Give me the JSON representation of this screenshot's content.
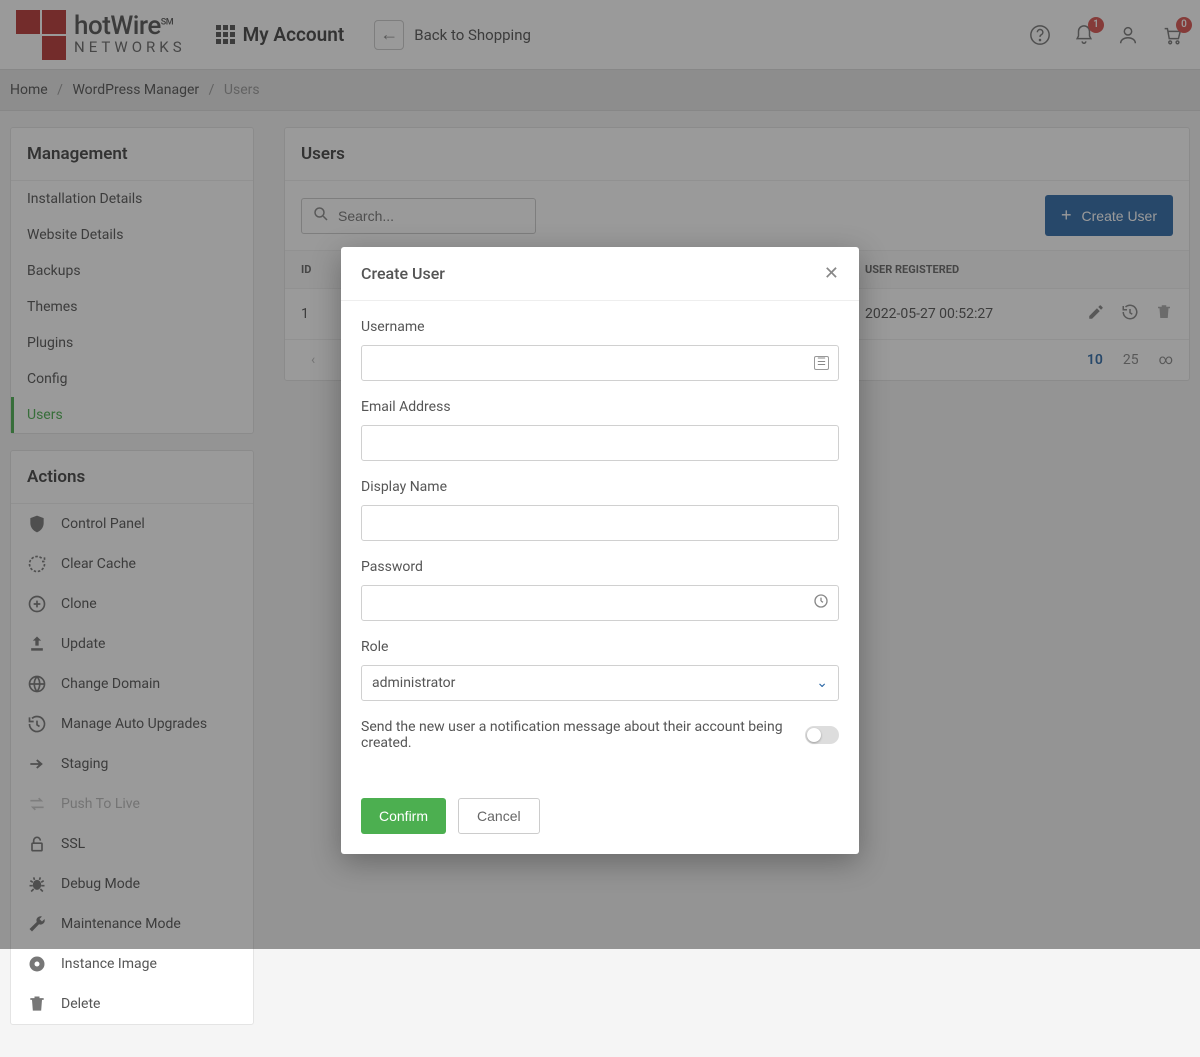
{
  "colors": {
    "accent_blue": "#2f6aa8",
    "accent_green": "#4caf50",
    "brand_red": "#b83836",
    "badge_red": "#d9534f"
  },
  "header": {
    "brand_line1": "hotWire",
    "brand_sup": "SM",
    "brand_line2": "NETWORKS",
    "title": "My Account",
    "back_label": "Back to Shopping",
    "notif_count": "1",
    "cart_count": "0"
  },
  "breadcrumb": {
    "home": "Home",
    "level1": "WordPress Manager",
    "current": "Users"
  },
  "sidebar": {
    "management_title": "Management",
    "management": [
      {
        "label": "Installation Details"
      },
      {
        "label": "Website Details"
      },
      {
        "label": "Backups"
      },
      {
        "label": "Themes"
      },
      {
        "label": "Plugins"
      },
      {
        "label": "Config"
      },
      {
        "label": "Users",
        "active": true
      }
    ],
    "actions_title": "Actions",
    "actions": [
      {
        "label": "Control Panel",
        "icon": "shield"
      },
      {
        "label": "Clear Cache",
        "icon": "refresh-dash"
      },
      {
        "label": "Clone",
        "icon": "plus-circle"
      },
      {
        "label": "Update",
        "icon": "upload"
      },
      {
        "label": "Change Domain",
        "icon": "globe"
      },
      {
        "label": "Manage Auto Upgrades",
        "icon": "history"
      },
      {
        "label": "Staging",
        "icon": "arrow-right"
      },
      {
        "label": "Push To Live",
        "icon": "swap",
        "disabled": true
      },
      {
        "label": "SSL",
        "icon": "lock"
      },
      {
        "label": "Debug Mode",
        "icon": "bug"
      },
      {
        "label": "Maintenance Mode",
        "icon": "wrench"
      },
      {
        "label": "Instance Image",
        "icon": "disc"
      },
      {
        "label": "Delete",
        "icon": "trash"
      }
    ]
  },
  "main": {
    "title": "Users",
    "search_placeholder": "Search...",
    "create_label": "Create User",
    "columns": {
      "id": "ID",
      "registered": "USER REGISTERED"
    },
    "rows": [
      {
        "id": "1",
        "registered": "2022-05-27 00:52:27"
      }
    ],
    "pager": {
      "p1": "10",
      "p2": "25",
      "inf": "∞"
    }
  },
  "modal": {
    "title": "Create User",
    "username_label": "Username",
    "email_label": "Email Address",
    "displayname_label": "Display Name",
    "password_label": "Password",
    "role_label": "Role",
    "role_value": "administrator",
    "notify_text": "Send the new user a notification message about their account being created.",
    "confirm_label": "Confirm",
    "cancel_label": "Cancel"
  }
}
